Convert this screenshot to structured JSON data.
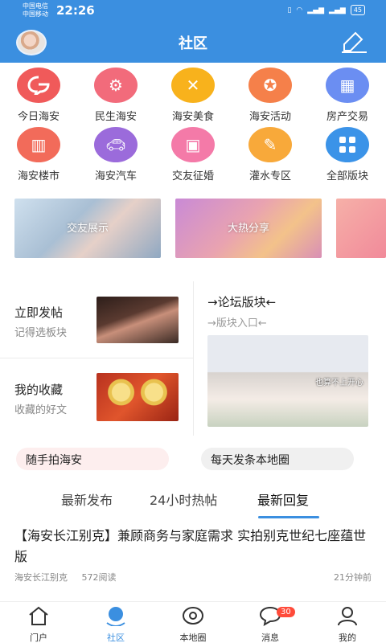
{
  "status": {
    "carrier1": "中国电信",
    "carrier2": "中国移动",
    "time": "22:26",
    "battery": "45"
  },
  "header": {
    "title": "社区"
  },
  "grid": [
    {
      "label": "今日海安",
      "color": "#f05a5a",
      "icon": "chat-bubble-icon"
    },
    {
      "label": "民生海安",
      "color": "#f26b7b",
      "icon": "gears-icon"
    },
    {
      "label": "海安美食",
      "color": "#f8b21c",
      "icon": "utensils-icon"
    },
    {
      "label": "海安活动",
      "color": "#f5804a",
      "icon": "activity-icon"
    },
    {
      "label": "房产交易",
      "color": "#6b8ef2",
      "icon": "building-icon"
    },
    {
      "label": "海安楼市",
      "color": "#f26b5a",
      "icon": "buildings-icon"
    },
    {
      "label": "海安汽车",
      "color": "#9b6bdb",
      "icon": "car-icon"
    },
    {
      "label": "交友征婚",
      "color": "#f47aa8",
      "icon": "id-card-icon"
    },
    {
      "label": "灌水专区",
      "color": "#f8a93a",
      "icon": "megaphone-icon"
    },
    {
      "label": "全部版块",
      "color": "#3b93e8",
      "icon": "grid-icon"
    }
  ],
  "banners": [
    {
      "label": "交友展示"
    },
    {
      "label": "大热分享"
    }
  ],
  "quick": {
    "post_title": "立即发帖",
    "post_sub": "记得选板块",
    "fav_title": "我的收藏",
    "fav_sub": "收藏的好文",
    "forum_title": "→论坛版块←",
    "forum_sub": "→版块入口←",
    "forum_image_caption": "也算不上开心"
  },
  "tags": [
    {
      "label": "随手拍海安"
    },
    {
      "label": "每天发条本地圈"
    }
  ],
  "tabs": [
    {
      "label": "最新发布"
    },
    {
      "label": "24小时热帖"
    },
    {
      "label": "最新回复"
    }
  ],
  "post": {
    "title": "【海安长江别克】兼顾商务与家庭需求 实拍别克世纪七座蕴世版",
    "author": "海安长江别克",
    "reads": "572阅读",
    "time": "21分钟前"
  },
  "nav": [
    {
      "label": "门户",
      "icon": "home-icon"
    },
    {
      "label": "社区",
      "icon": "community-icon"
    },
    {
      "label": "本地圈",
      "icon": "circle-icon"
    },
    {
      "label": "消息",
      "icon": "message-icon",
      "badge": "30"
    },
    {
      "label": "我的",
      "icon": "user-icon"
    }
  ],
  "colors": {
    "accent": "#3b8fe0",
    "badge": "#ff4b3a"
  }
}
